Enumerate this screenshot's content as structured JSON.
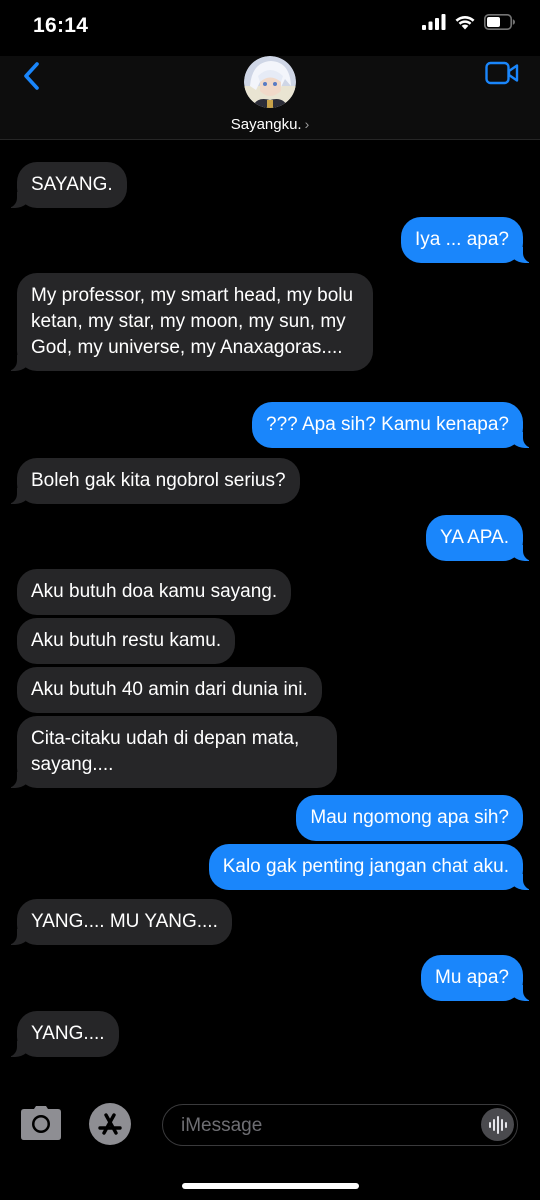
{
  "status_bar": {
    "time": "16:14"
  },
  "header": {
    "contact_name": "Sayangku.",
    "icons": {
      "back": "chevron-left-icon",
      "video": "video-camera-icon",
      "avatar": "contact-avatar"
    }
  },
  "colors": {
    "incoming_bubble": "#262628",
    "outgoing_bubble": "#1a86fb",
    "accent": "#1a86fb",
    "background": "#000000"
  },
  "messages": [
    {
      "from": "them",
      "text": "SAYANG."
    },
    {
      "from": "me",
      "text": "Iya ... apa?"
    },
    {
      "from": "them",
      "text": "My professor, my smart head, my bolu ketan, my star, my moon, my sun, my God, my universe, my Anaxagoras...."
    },
    {
      "from": "me",
      "text": "??? Apa sih? Kamu kenapa?"
    },
    {
      "from": "them",
      "text": "Boleh gak kita ngobrol serius?"
    },
    {
      "from": "me",
      "text": "YA APA."
    },
    {
      "from": "them",
      "text": "Aku butuh doa kamu sayang."
    },
    {
      "from": "them",
      "text": "Aku butuh restu kamu."
    },
    {
      "from": "them",
      "text": "Aku butuh 40 amin dari dunia ini."
    },
    {
      "from": "them",
      "text": "Cita-citaku udah di depan mata, sayang...."
    },
    {
      "from": "me",
      "text": "Mau ngomong apa sih?"
    },
    {
      "from": "me",
      "text": "Kalo gak penting jangan chat aku."
    },
    {
      "from": "them",
      "text": "YANG.... MU YANG...."
    },
    {
      "from": "me",
      "text": "Mu apa?"
    },
    {
      "from": "them",
      "text": "YANG...."
    }
  ],
  "input_bar": {
    "placeholder": "iMessage",
    "icons": {
      "camera": "camera-icon",
      "apps": "app-store-icon",
      "audio": "audio-waveform-icon"
    }
  }
}
